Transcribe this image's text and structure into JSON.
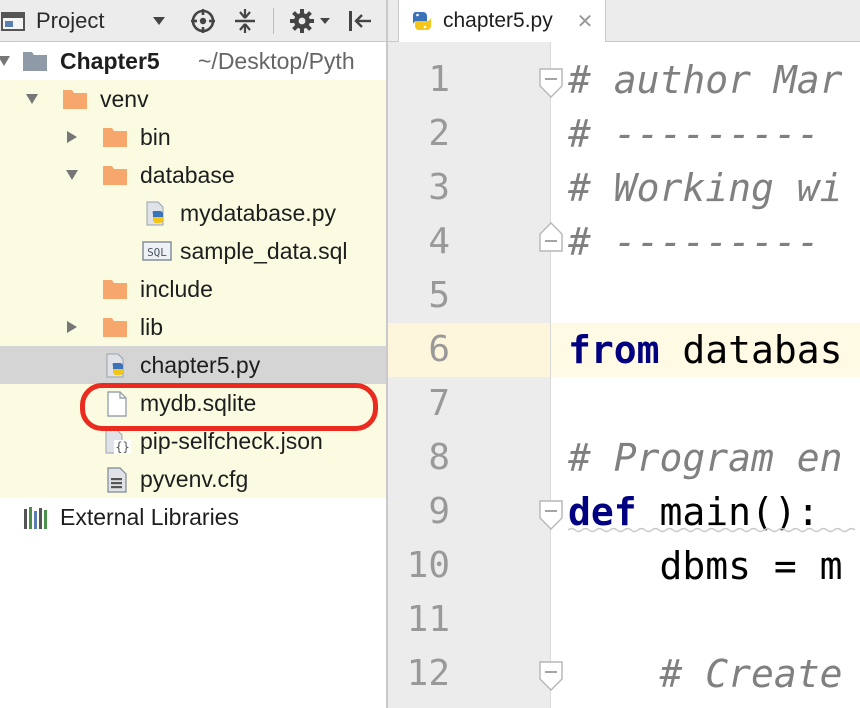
{
  "project_panel": {
    "title": "Project",
    "tree": [
      {
        "label": "Chapter5",
        "path": "~/Desktop/Pyth"
      },
      {
        "label": "venv"
      },
      {
        "label": "bin"
      },
      {
        "label": "database"
      },
      {
        "label": "mydatabase.py"
      },
      {
        "label": "sample_data.sql"
      },
      {
        "label": "include"
      },
      {
        "label": "lib"
      },
      {
        "label": "chapter5.py"
      },
      {
        "label": "mydb.sqlite"
      },
      {
        "label": "pip-selfcheck.json"
      },
      {
        "label": "pyvenv.cfg"
      },
      {
        "label": "External Libraries"
      }
    ],
    "highlighted_item": "mydb.sqlite",
    "icons": [
      "project-window-icon",
      "chevron-down-icon",
      "crosshair-icon",
      "collapse-all-icon",
      "gear-icon",
      "hide-panel-icon",
      "folder-icon",
      "python-file-icon",
      "sql-file-icon",
      "text-file-icon",
      "json-file-icon",
      "config-file-icon",
      "library-icon"
    ]
  },
  "editor": {
    "tab": {
      "label": "chapter5.py"
    },
    "line_numbers": [
      "1",
      "2",
      "3",
      "4",
      "5",
      "6",
      "7",
      "8",
      "9",
      "10",
      "11",
      "12"
    ],
    "lines": {
      "l1": "# author Mar",
      "l2": "# ---------",
      "l3": "# Working wi",
      "l4": "# ---------",
      "l6_kw": "from",
      "l6_rest": " databas",
      "l8": "# Program en",
      "l9_kw": "def",
      "l9_rest": " main():",
      "l10": "    dbms = m",
      "l12": "    # Create"
    },
    "current_line": "6"
  },
  "colors": {
    "highlight_ring": "#ea2b1f",
    "vcs_row_bg": "#fbfbe2",
    "selected_row_bg": "#d5d5d5",
    "folder": "#f8a76c",
    "keyword": "#000080",
    "comment": "#808080",
    "caret_row": "#fffae3"
  }
}
